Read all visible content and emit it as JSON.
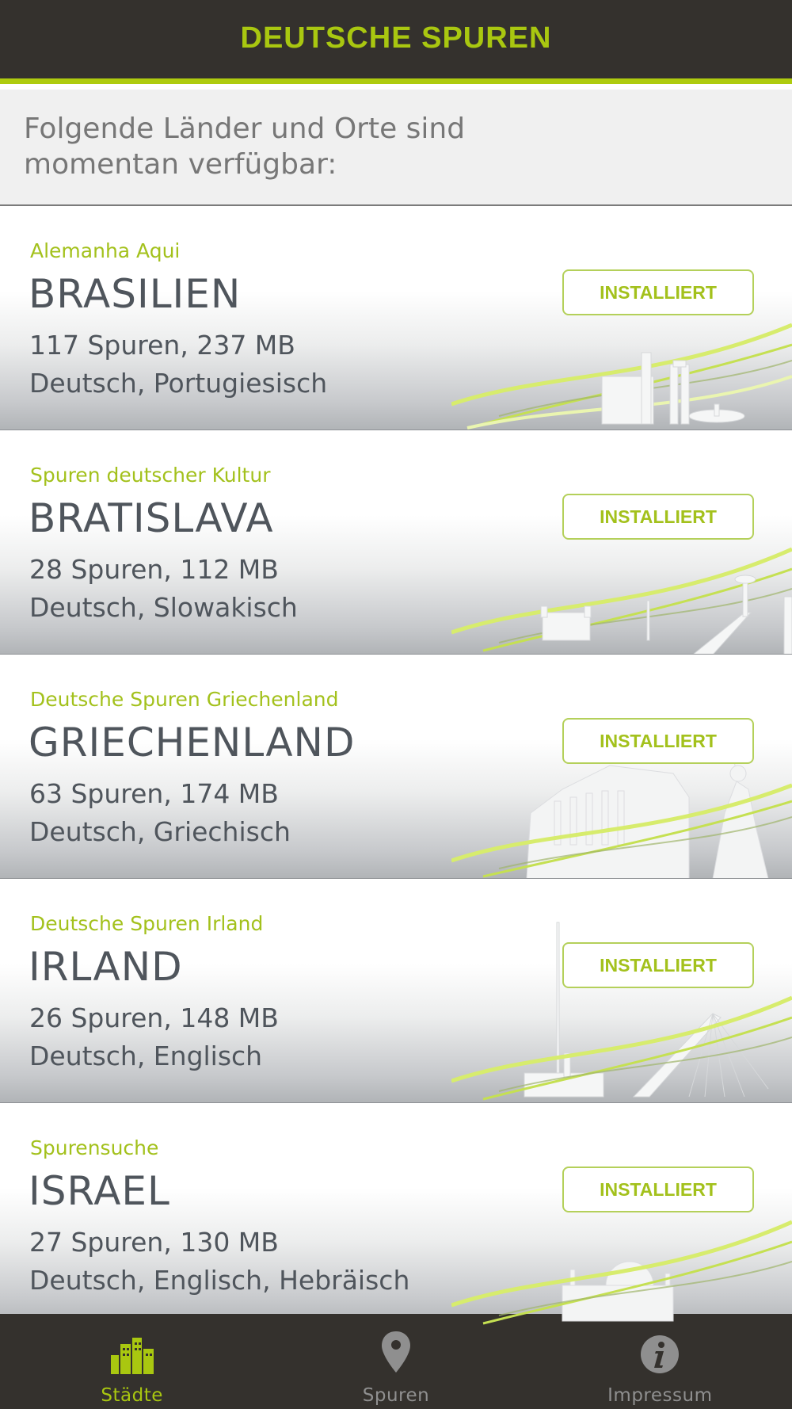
{
  "app": {
    "title": "DEUTSCHE SPUREN"
  },
  "intro": {
    "text": "Folgende Länder und Orte sind momentan verfügbar:"
  },
  "cards": [
    {
      "subtitle": "Alemanha Aqui",
      "name": "BRASILIEN",
      "tracks": "117 Spuren, 237 MB",
      "languages": "Deutsch, Portugiesisch",
      "button": "INSTALLIERT",
      "skyline_icon": "brasilia-skyline-icon"
    },
    {
      "subtitle": "Spuren deutscher Kultur",
      "name": "BRATISLAVA",
      "tracks": "28 Spuren, 112 MB",
      "languages": "Deutsch, Slowakisch",
      "button": "INSTALLIERT",
      "skyline_icon": "bratislava-skyline-icon"
    },
    {
      "subtitle": "Deutsche Spuren Griechenland",
      "name": "GRIECHENLAND",
      "tracks": "63 Spuren, 174 MB",
      "languages": "Deutsch, Griechisch",
      "button": "INSTALLIERT",
      "skyline_icon": "acropolis-skyline-icon"
    },
    {
      "subtitle": "Deutsche Spuren Irland",
      "name": "IRLAND",
      "tracks": "26 Spuren, 148 MB",
      "languages": "Deutsch, Englisch",
      "button": "INSTALLIERT",
      "skyline_icon": "dublin-skyline-icon"
    },
    {
      "subtitle": "Spurensuche",
      "name": "ISRAEL",
      "tracks": "27 Spuren, 130 MB",
      "languages": "Deutsch, Englisch, Hebräisch",
      "button": "INSTALLIERT",
      "skyline_icon": "jerusalem-skyline-icon"
    }
  ],
  "tabbar": {
    "tabs": [
      {
        "label": "Städte",
        "icon": "city-icon",
        "active": true
      },
      {
        "label": "Spuren",
        "icon": "map-pin-icon",
        "active": false
      },
      {
        "label": "Impressum",
        "icon": "info-icon",
        "active": false
      }
    ]
  },
  "colors": {
    "accent": "#a9c710",
    "header_bg": "#34312d",
    "text_dark": "#4f555c",
    "text_muted": "#777777"
  }
}
